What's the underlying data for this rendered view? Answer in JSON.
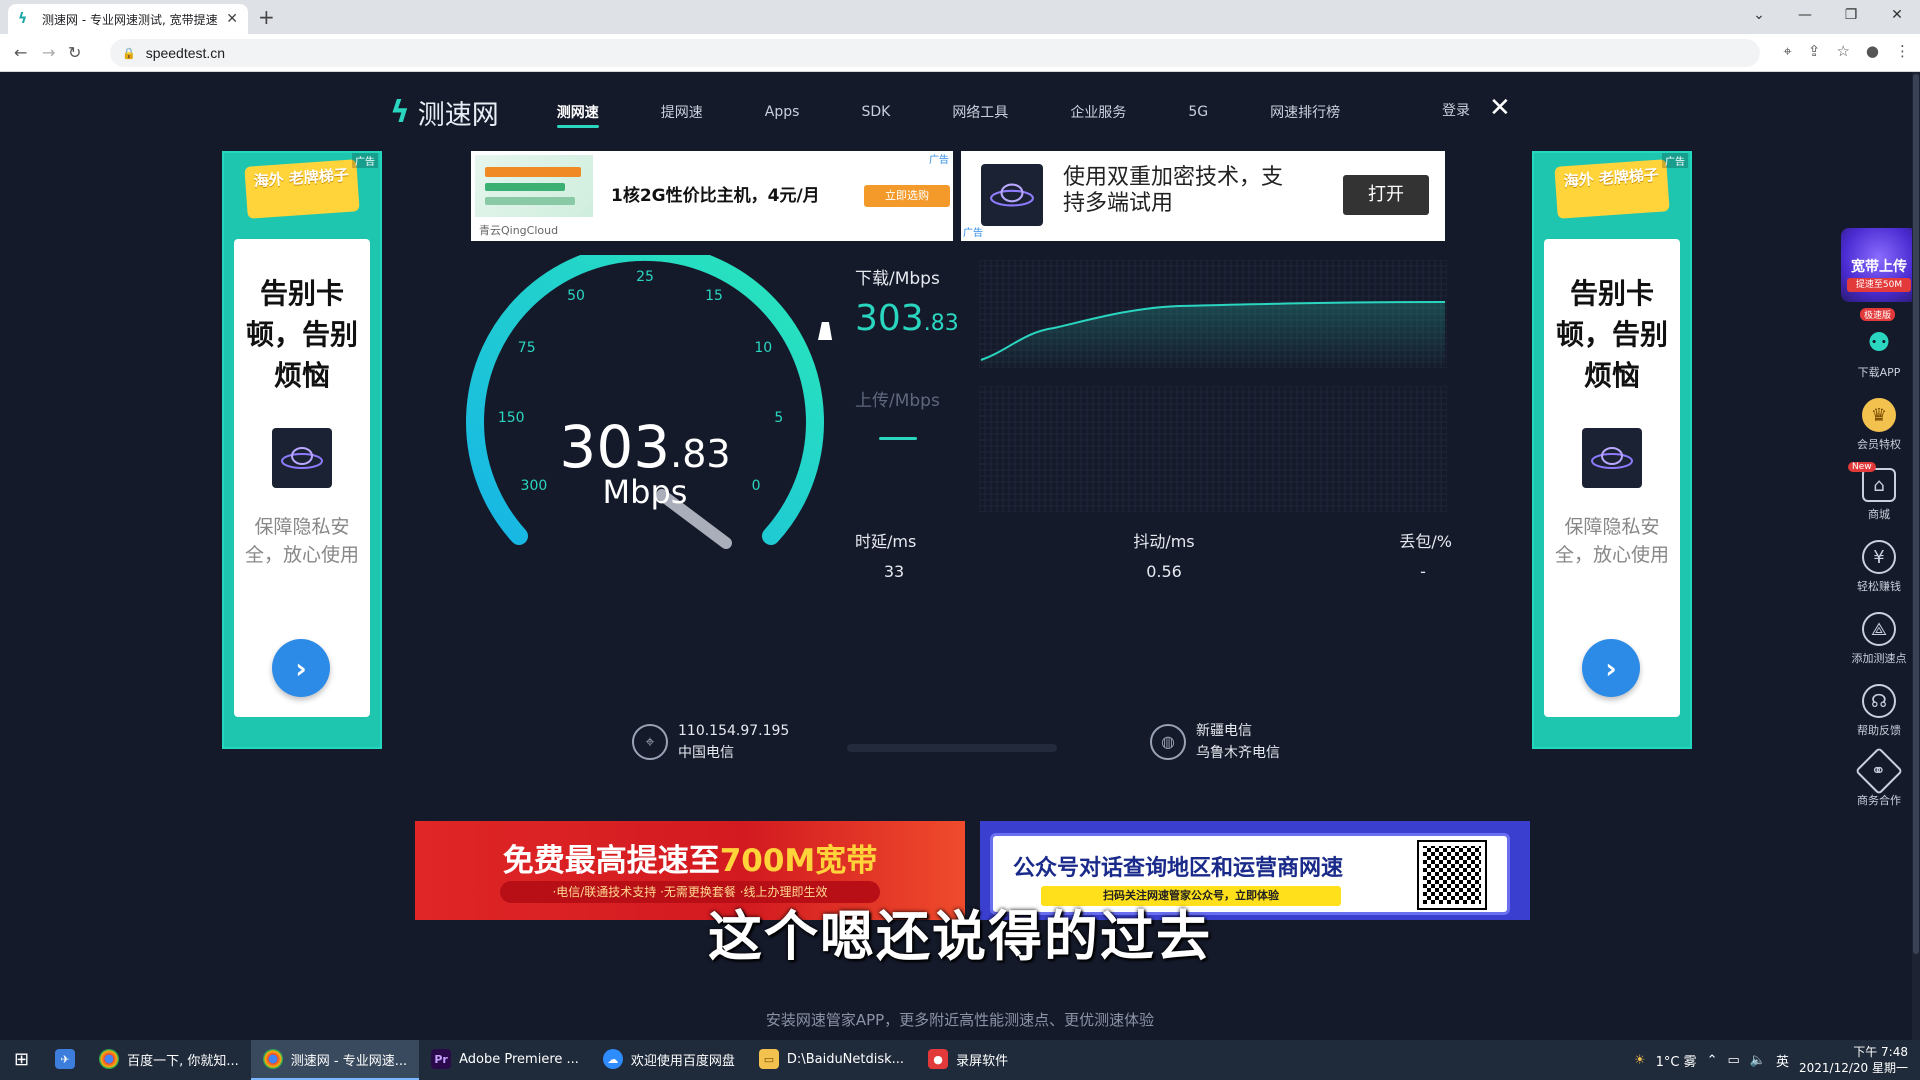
{
  "browser": {
    "tab_title": "测速网 - 专业网速测试, 宽带提速",
    "url": "speedtest.cn"
  },
  "nav": {
    "logo": "测速网",
    "items": [
      "测网速",
      "提网速",
      "Apps",
      "SDK",
      "网络工具",
      "企业服务",
      "5G",
      "网速排行榜"
    ],
    "login": "登录"
  },
  "side_ad": {
    "ribbon": "海外 老牌梯子",
    "headline": "告别卡顿，告别烦恼",
    "desc": "保障隐私安全，放心使用",
    "ad_tag": "广告"
  },
  "top_ad_1": {
    "text": "1核2G性价比主机，4元/月",
    "button": "立即选购",
    "brand": "青云QingCloud",
    "ad_tag": "广告"
  },
  "top_ad_2": {
    "text": "使用双重加密技术，支持多端试用",
    "button": "打开",
    "ad_tag": "广告"
  },
  "gauge": {
    "value_int": "303",
    "value_dec": ".83",
    "unit": "Mbps",
    "ticks": [
      "0",
      "5",
      "10",
      "15",
      "25",
      "50",
      "75",
      "150",
      "300"
    ],
    "accent": "#2ad6c0"
  },
  "download": {
    "label": "下载/Mbps",
    "value_int": "303",
    "value_dec": ".83"
  },
  "upload": {
    "label": "上传/Mbps"
  },
  "metrics": [
    {
      "label": "时延/ms",
      "value": "33"
    },
    {
      "label": "抖动/ms",
      "value": "0.56"
    },
    {
      "label": "丢包/%",
      "value": "-"
    }
  ],
  "client": {
    "ip": "110.154.97.195",
    "isp": "中国电信"
  },
  "server": {
    "name": "新疆电信",
    "city": "乌鲁木齐电信"
  },
  "bottom_ad_1": {
    "title_a": "免费最高提速至",
    "title_b": "700M宽带",
    "sub": "·电信/联通技术支持 ·无需更换套餐 ·线上办理即生效"
  },
  "bottom_ad_2": {
    "title": "公众号对话查询地区和运营商网速",
    "sub": "扫码关注网速管家公众号，立即体验"
  },
  "subtitle": "这个嗯还说得的过去",
  "footer": "安装网速管家APP，更多附近高性能测速点、更优测速体验",
  "right_toolbar": {
    "promo_title": "宽带上传",
    "promo_sub": "提速至50M",
    "promo_badge": "极速版",
    "items": [
      {
        "label": "下载APP",
        "badge": ""
      },
      {
        "label": "会员特权",
        "badge": ""
      },
      {
        "label": "商城",
        "badge": "New"
      },
      {
        "label": "轻松赚钱",
        "badge": ""
      },
      {
        "label": "添加测速点",
        "badge": ""
      },
      {
        "label": "帮助反馈",
        "badge": ""
      },
      {
        "label": "商务合作",
        "badge": ""
      }
    ]
  },
  "taskbar": {
    "items": [
      {
        "label": "百度一下, 你就知...",
        "icon": "chrome-icon"
      },
      {
        "label": "测速网 - 专业网速...",
        "icon": "chrome-icon"
      },
      {
        "label": "Adobe Premiere ...",
        "icon": "premiere-icon",
        "short": "Pr"
      },
      {
        "label": "欢迎使用百度网盘",
        "icon": "baidu-netdisk-icon"
      },
      {
        "label": "D:\\BaiduNetdisk...",
        "icon": "folder-icon"
      },
      {
        "label": "录屏软件",
        "icon": "recorder-icon"
      }
    ],
    "weather": "1°C 雾",
    "ime": "英",
    "time": "下午 7:48",
    "date": "2021/12/20 星期一"
  }
}
